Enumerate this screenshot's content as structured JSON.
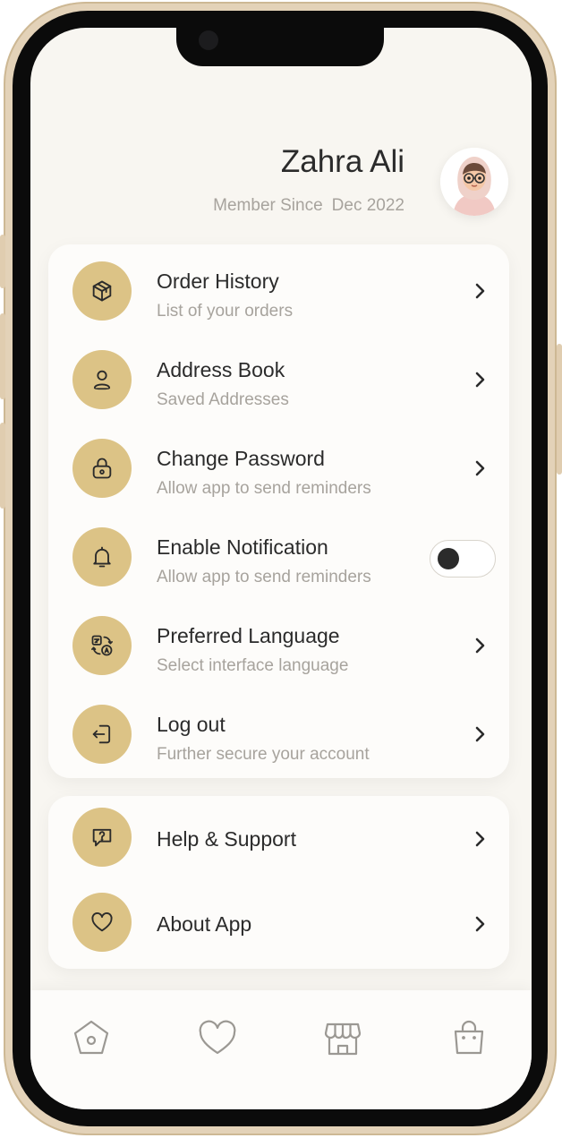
{
  "profile": {
    "name": "Zahra Ali",
    "member_since_label": "Member Since",
    "member_since_date": "Dec 2022"
  },
  "menu_main": [
    {
      "title": "Order History",
      "subtitle": "List of your orders",
      "icon": "box-icon"
    },
    {
      "title": "Address Book",
      "subtitle": "Saved Addresses",
      "icon": "person-icon"
    },
    {
      "title": "Change Password",
      "subtitle": "Allow app to send reminders",
      "icon": "lock-icon"
    },
    {
      "title": "Enable Notification",
      "subtitle": "Allow app to send reminders",
      "icon": "bell-icon",
      "toggle_on": false
    },
    {
      "title": "Preferred Language",
      "subtitle": "Select interface language",
      "icon": "translate-icon"
    },
    {
      "title": "Log out",
      "subtitle": "Further secure your account",
      "icon": "logout-icon"
    }
  ],
  "menu_extra": [
    {
      "title": "Help & Support",
      "icon": "help-chat-icon"
    },
    {
      "title": "About App",
      "icon": "heart-icon"
    }
  ],
  "bottom_nav": [
    "home-icon",
    "favorites-icon",
    "store-icon",
    "shopping-bag-icon"
  ],
  "colors": {
    "accent": "#dcc386",
    "background": "#f8f6f1",
    "text_primary": "#2b2b2b",
    "text_secondary": "#a7a39d",
    "frame": "#e3d2b8"
  }
}
